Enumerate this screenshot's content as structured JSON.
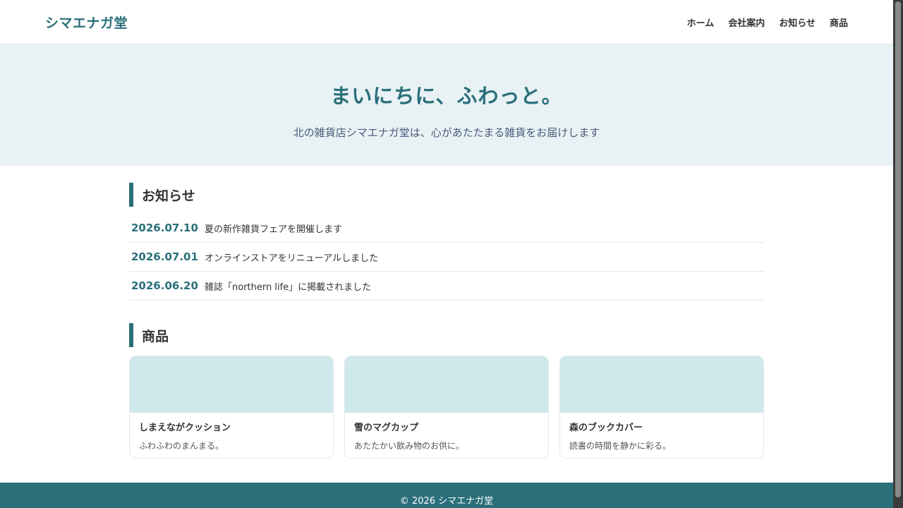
{
  "header": {
    "logo": "シマエナガ堂",
    "nav": [
      "ホーム",
      "会社案内",
      "お知らせ",
      "商品"
    ]
  },
  "hero": {
    "title": "まいにちに、ふわっと。",
    "subtitle": "北の雑貨店シマエナガ堂は、心があたたまる雑貨をお届けします"
  },
  "news": {
    "heading": "お知らせ",
    "items": [
      {
        "date": "2026.07.10",
        "title": "夏の新作雑貨フェアを開催します"
      },
      {
        "date": "2026.07.01",
        "title": "オンラインストアをリニューアルしました"
      },
      {
        "date": "2026.06.20",
        "title": "雑誌「northern life」に掲載されました"
      }
    ]
  },
  "products": {
    "heading": "商品",
    "items": [
      {
        "name": "しまえながクッション",
        "description": "ふわふわのまんまる。"
      },
      {
        "name": "雪のマグカップ",
        "description": "あたたかい飲み物のお供に。"
      },
      {
        "name": "森のブックカバー",
        "description": "読書の時間を静かに彩る。"
      }
    ]
  },
  "footer": {
    "copyright": "© 2026 シマエナガ堂"
  },
  "colors": {
    "accent": "#2a6f7a",
    "hero_bg": "#e8f2f5",
    "product_image_bg": "#cfe8eb"
  }
}
